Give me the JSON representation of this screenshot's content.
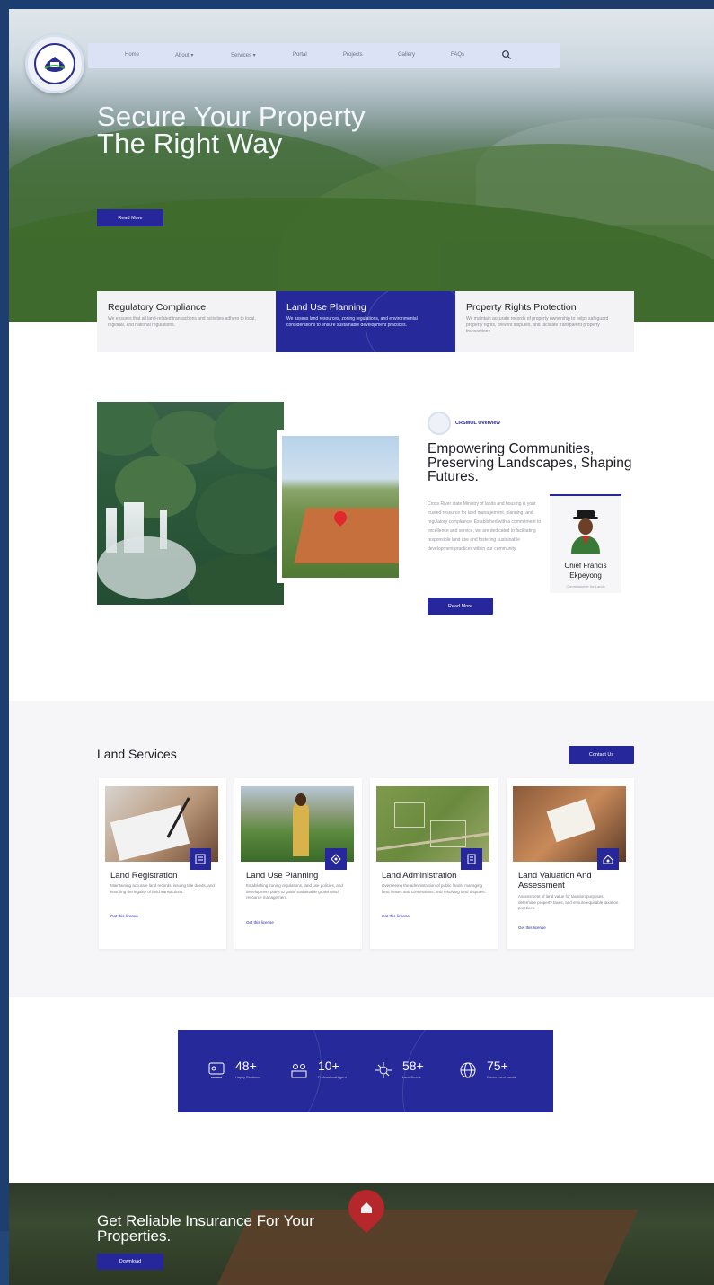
{
  "nav": {
    "items": [
      "Home",
      "About ▾",
      "Services ▾",
      "Portal",
      "Projects",
      "Gallery",
      "FAQs"
    ],
    "search_icon": "search-icon"
  },
  "hero": {
    "title": "Secure Your Property The Right Way",
    "button": "Read More"
  },
  "features": [
    {
      "title": "Regulatory Compliance",
      "text": "We ensures that all land-related transactions and activities adhere to local, regional, and national regulations."
    },
    {
      "title": "Land Use Planning",
      "text": "We assess land resources, zoning regulations, and environmental considerations to ensure sustainable development practices."
    },
    {
      "title": "Property Rights Protection",
      "text": "We maintain accurate records of property ownership to helps safeguard property rights, prevent disputes, and facilitate transparent property transactions."
    }
  ],
  "about": {
    "label": "CRSMOL Overview",
    "title": "Empowering Communities, Preserving Landscapes, Shaping Futures.",
    "text": "Cross River state Ministry of lands and housing is your trusted resource for land management, planning, and regulatory compliance. Established with a commitment to excellence and service, we are dedicated to facilitating responsible land use and fostering sustainable development practices within our community.",
    "chief_name": "Chief Francis Ekpeyong",
    "chief_role": "Commissioner for Lands",
    "button": "Read More"
  },
  "services": {
    "title": "Land Services",
    "contact_button": "Contact Us",
    "cards": [
      {
        "title": "Land Registration",
        "text": "Maintaining accurate land records, issuing title deeds, and ensuring the legality of land transactions.",
        "link": "Get this license"
      },
      {
        "title": "Land Use Planning",
        "text": "Establishing zoning regulations, land use policies, and development plans to guide sustainable growth and resource management.",
        "link": "Get this license"
      },
      {
        "title": "Land Administration",
        "text": "Overseeing the administration of public lands, managing land leases and concessions, and resolving land disputes.",
        "link": "Get this license"
      },
      {
        "title": "Land Valuation And Assessment",
        "text": "Assessment of land value for taxation purposes, determine property taxes, and ensure equitable taxation practices.",
        "link": "Get this license"
      }
    ]
  },
  "stats": [
    {
      "num": "48+",
      "label": "Happy Customer"
    },
    {
      "num": "10+",
      "label": "Professional Agent"
    },
    {
      "num": "58+",
      "label": "Land Deeds"
    },
    {
      "num": "75+",
      "label": "Government Lands"
    }
  ],
  "insurance": {
    "title": "Get Reliable Insurance For Your Properties.",
    "button": "Download"
  },
  "colors": {
    "brand": "#26299a",
    "nav_bg": "#dbe2f6",
    "frame": "#1d3b6b"
  }
}
